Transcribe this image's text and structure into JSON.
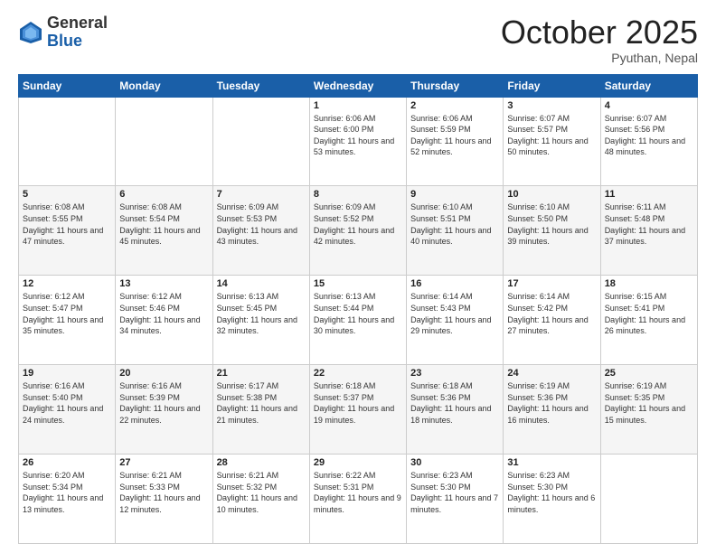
{
  "header": {
    "logo": {
      "general": "General",
      "blue": "Blue"
    },
    "title": "October 2025",
    "location": "Pyuthan, Nepal"
  },
  "days_of_week": [
    "Sunday",
    "Monday",
    "Tuesday",
    "Wednesday",
    "Thursday",
    "Friday",
    "Saturday"
  ],
  "weeks": [
    [
      {
        "day": "",
        "info": ""
      },
      {
        "day": "",
        "info": ""
      },
      {
        "day": "",
        "info": ""
      },
      {
        "day": "1",
        "info": "Sunrise: 6:06 AM\nSunset: 6:00 PM\nDaylight: 11 hours\nand 53 minutes."
      },
      {
        "day": "2",
        "info": "Sunrise: 6:06 AM\nSunset: 5:59 PM\nDaylight: 11 hours\nand 52 minutes."
      },
      {
        "day": "3",
        "info": "Sunrise: 6:07 AM\nSunset: 5:57 PM\nDaylight: 11 hours\nand 50 minutes."
      },
      {
        "day": "4",
        "info": "Sunrise: 6:07 AM\nSunset: 5:56 PM\nDaylight: 11 hours\nand 48 minutes."
      }
    ],
    [
      {
        "day": "5",
        "info": "Sunrise: 6:08 AM\nSunset: 5:55 PM\nDaylight: 11 hours\nand 47 minutes."
      },
      {
        "day": "6",
        "info": "Sunrise: 6:08 AM\nSunset: 5:54 PM\nDaylight: 11 hours\nand 45 minutes."
      },
      {
        "day": "7",
        "info": "Sunrise: 6:09 AM\nSunset: 5:53 PM\nDaylight: 11 hours\nand 43 minutes."
      },
      {
        "day": "8",
        "info": "Sunrise: 6:09 AM\nSunset: 5:52 PM\nDaylight: 11 hours\nand 42 minutes."
      },
      {
        "day": "9",
        "info": "Sunrise: 6:10 AM\nSunset: 5:51 PM\nDaylight: 11 hours\nand 40 minutes."
      },
      {
        "day": "10",
        "info": "Sunrise: 6:10 AM\nSunset: 5:50 PM\nDaylight: 11 hours\nand 39 minutes."
      },
      {
        "day": "11",
        "info": "Sunrise: 6:11 AM\nSunset: 5:48 PM\nDaylight: 11 hours\nand 37 minutes."
      }
    ],
    [
      {
        "day": "12",
        "info": "Sunrise: 6:12 AM\nSunset: 5:47 PM\nDaylight: 11 hours\nand 35 minutes."
      },
      {
        "day": "13",
        "info": "Sunrise: 6:12 AM\nSunset: 5:46 PM\nDaylight: 11 hours\nand 34 minutes."
      },
      {
        "day": "14",
        "info": "Sunrise: 6:13 AM\nSunset: 5:45 PM\nDaylight: 11 hours\nand 32 minutes."
      },
      {
        "day": "15",
        "info": "Sunrise: 6:13 AM\nSunset: 5:44 PM\nDaylight: 11 hours\nand 30 minutes."
      },
      {
        "day": "16",
        "info": "Sunrise: 6:14 AM\nSunset: 5:43 PM\nDaylight: 11 hours\nand 29 minutes."
      },
      {
        "day": "17",
        "info": "Sunrise: 6:14 AM\nSunset: 5:42 PM\nDaylight: 11 hours\nand 27 minutes."
      },
      {
        "day": "18",
        "info": "Sunrise: 6:15 AM\nSunset: 5:41 PM\nDaylight: 11 hours\nand 26 minutes."
      }
    ],
    [
      {
        "day": "19",
        "info": "Sunrise: 6:16 AM\nSunset: 5:40 PM\nDaylight: 11 hours\nand 24 minutes."
      },
      {
        "day": "20",
        "info": "Sunrise: 6:16 AM\nSunset: 5:39 PM\nDaylight: 11 hours\nand 22 minutes."
      },
      {
        "day": "21",
        "info": "Sunrise: 6:17 AM\nSunset: 5:38 PM\nDaylight: 11 hours\nand 21 minutes."
      },
      {
        "day": "22",
        "info": "Sunrise: 6:18 AM\nSunset: 5:37 PM\nDaylight: 11 hours\nand 19 minutes."
      },
      {
        "day": "23",
        "info": "Sunrise: 6:18 AM\nSunset: 5:36 PM\nDaylight: 11 hours\nand 18 minutes."
      },
      {
        "day": "24",
        "info": "Sunrise: 6:19 AM\nSunset: 5:36 PM\nDaylight: 11 hours\nand 16 minutes."
      },
      {
        "day": "25",
        "info": "Sunrise: 6:19 AM\nSunset: 5:35 PM\nDaylight: 11 hours\nand 15 minutes."
      }
    ],
    [
      {
        "day": "26",
        "info": "Sunrise: 6:20 AM\nSunset: 5:34 PM\nDaylight: 11 hours\nand 13 minutes."
      },
      {
        "day": "27",
        "info": "Sunrise: 6:21 AM\nSunset: 5:33 PM\nDaylight: 11 hours\nand 12 minutes."
      },
      {
        "day": "28",
        "info": "Sunrise: 6:21 AM\nSunset: 5:32 PM\nDaylight: 11 hours\nand 10 minutes."
      },
      {
        "day": "29",
        "info": "Sunrise: 6:22 AM\nSunset: 5:31 PM\nDaylight: 11 hours\nand 9 minutes."
      },
      {
        "day": "30",
        "info": "Sunrise: 6:23 AM\nSunset: 5:30 PM\nDaylight: 11 hours\nand 7 minutes."
      },
      {
        "day": "31",
        "info": "Sunrise: 6:23 AM\nSunset: 5:30 PM\nDaylight: 11 hours\nand 6 minutes."
      },
      {
        "day": "",
        "info": ""
      }
    ]
  ]
}
